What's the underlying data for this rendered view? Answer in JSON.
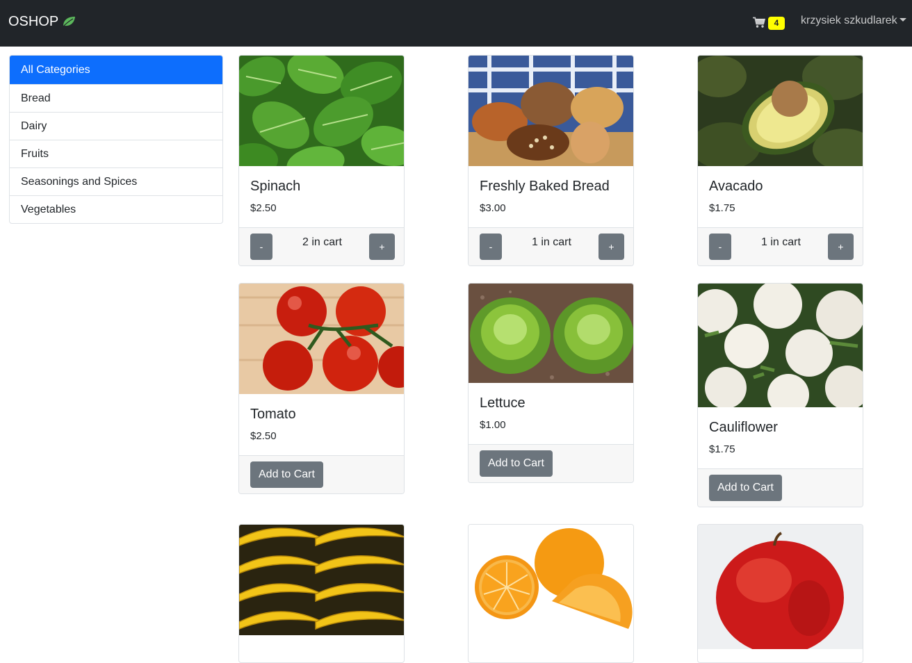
{
  "navbar": {
    "brand": "OSHOP",
    "brand_icon": "leaf-icon",
    "cart_icon": "shopping-cart-icon",
    "cart_count": "4",
    "user_name": "krzysiek szkudlarek"
  },
  "categories": [
    {
      "label": "All Categories",
      "active": true
    },
    {
      "label": "Bread",
      "active": false
    },
    {
      "label": "Dairy",
      "active": false
    },
    {
      "label": "Fruits",
      "active": false
    },
    {
      "label": "Seasonings and Spices",
      "active": false
    },
    {
      "label": "Vegetables",
      "active": false
    }
  ],
  "products": [
    {
      "title": "Spinach",
      "price": "$2.50",
      "in_cart_label": "2 in cart",
      "minus": "-",
      "plus": "+"
    },
    {
      "title": "Freshly Baked Bread",
      "price": "$3.00",
      "in_cart_label": "1 in cart",
      "minus": "-",
      "plus": "+"
    },
    {
      "title": "Avacado",
      "price": "$1.75",
      "in_cart_label": "1 in cart",
      "minus": "-",
      "plus": "+"
    },
    {
      "title": "Tomato",
      "price": "$2.50",
      "add_label": "Add to Cart"
    },
    {
      "title": "Lettuce",
      "price": "$1.00",
      "add_label": "Add to Cart"
    },
    {
      "title": "Cauliflower",
      "price": "$1.75",
      "add_label": "Add to Cart"
    },
    {
      "title": "",
      "price": ""
    },
    {
      "title": "",
      "price": ""
    },
    {
      "title": "",
      "price": ""
    }
  ]
}
